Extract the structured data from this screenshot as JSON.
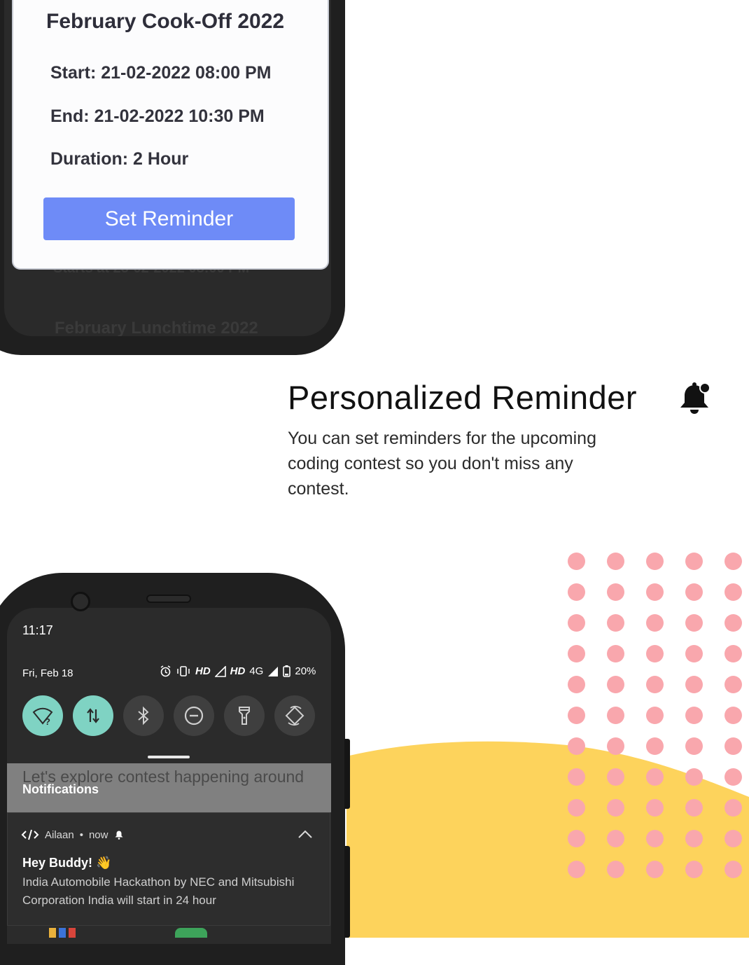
{
  "colors": {
    "accent_button": "#6e8bf7",
    "dot_pink": "#f9a7ad",
    "wave_yellow": "#fdd35c",
    "qs_active": "#7fd3c3"
  },
  "top_phone": {
    "card": {
      "title": "February Cook-Off 2022",
      "start": "Start: 21-02-2022 08:00 PM",
      "end": "End: 21-02-2022 10:30 PM",
      "duration": "Duration: 2 Hour",
      "button": "Set Reminder"
    },
    "background_items": [
      "Starts at 23-02-2022 08:00 PM",
      "February Lunchtime 2022"
    ]
  },
  "feature": {
    "title": "Personalized Reminder",
    "icon": "bell-alert-icon",
    "description": "You can set reminders for the upcoming coding contest so you don't miss any contest."
  },
  "bottom_phone": {
    "time": "11:17",
    "date": "Fri, Feb 18",
    "status": {
      "hd1": "HD",
      "hd2": "HD",
      "network": "4G",
      "battery": "20%"
    },
    "quick_settings": [
      {
        "name": "wifi",
        "icon": "wifi-unknown-icon",
        "active": true
      },
      {
        "name": "mobile-data",
        "icon": "data-arrows-icon",
        "active": true
      },
      {
        "name": "bluetooth",
        "icon": "bluetooth-icon",
        "active": false
      },
      {
        "name": "do-not-disturb",
        "icon": "dnd-icon",
        "active": false
      },
      {
        "name": "flashlight",
        "icon": "flashlight-icon",
        "active": false
      },
      {
        "name": "auto-rotate",
        "icon": "rotate-icon",
        "active": false
      }
    ],
    "behind_text": "Let's explore contest happening around",
    "notifications_label": "Notifications",
    "notification": {
      "app": "Ailaan",
      "separator": "•",
      "time": "now",
      "title": "Hey Buddy! 👋",
      "body": "India Automobile Hackathon by NEC and Mitsubishi Corporation India will start in 24 hour"
    }
  }
}
